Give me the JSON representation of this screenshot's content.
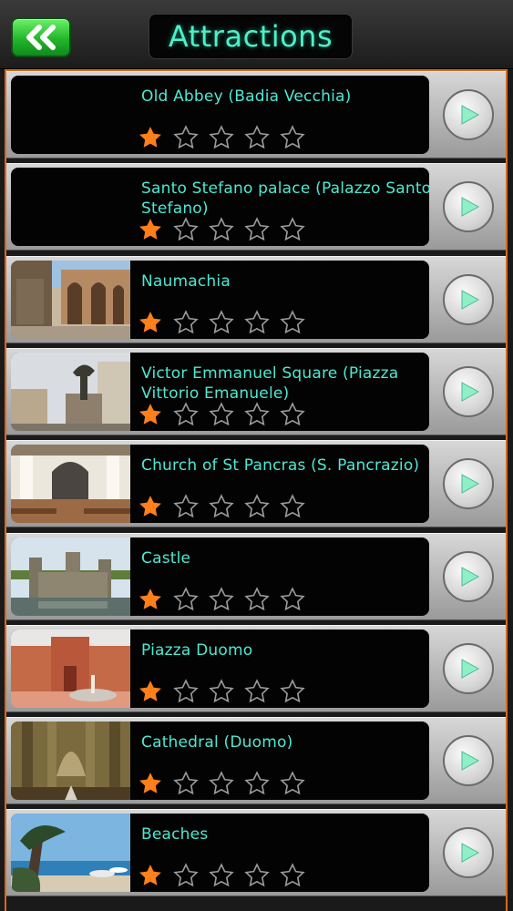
{
  "header": {
    "title": "Attractions",
    "back_icon": "double-chevron-left-icon"
  },
  "colors": {
    "accent": "#4ee8d2",
    "star_filled": "#ff7f1a",
    "list_border": "#d86a1f",
    "back_button": "#22b62a"
  },
  "rating_max": 5,
  "attractions": [
    {
      "title": "Old Abbey (Badia Vecchia)",
      "rating": 1,
      "thumbnail": "none"
    },
    {
      "title": "Santo Stefano palace (Palazzo Santo Stefano)",
      "rating": 1,
      "thumbnail": "none"
    },
    {
      "title": "Naumachia",
      "rating": 1,
      "thumbnail": "ruins-arches"
    },
    {
      "title": "Victor Emmanuel Square (Piazza Vittorio Emanuele)",
      "rating": 1,
      "thumbnail": "square-statue"
    },
    {
      "title": "Church of St Pancras (S. Pancrazio)",
      "rating": 1,
      "thumbnail": "church-interior"
    },
    {
      "title": "Castle",
      "rating": 1,
      "thumbnail": "castle-moat"
    },
    {
      "title": "Piazza Duomo",
      "rating": 1,
      "thumbnail": "piazza-fountain"
    },
    {
      "title": "Cathedral (Duomo)",
      "rating": 1,
      "thumbnail": "cathedral-nave"
    },
    {
      "title": "Beaches",
      "rating": 1,
      "thumbnail": "beach-tree"
    }
  ]
}
